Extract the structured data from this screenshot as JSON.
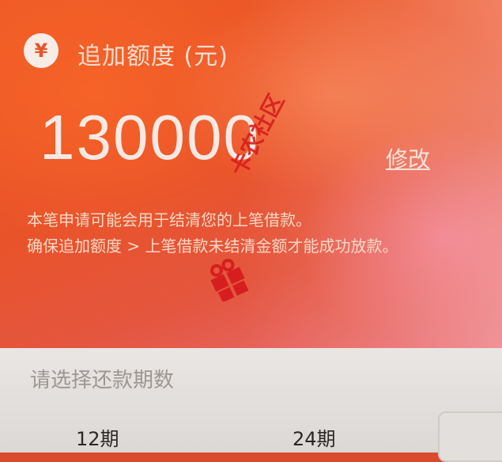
{
  "card": {
    "currency_icon": "yen-icon",
    "currency_symbol": "¥",
    "title": "追加额度 (元)",
    "amount": "130000",
    "edit_label": "修改",
    "note_line1": "本笔申请可能会用于结清您的上笔借款。",
    "note_line2": "确保追加额度 > 上笔借款未结清金额才能成功放款。"
  },
  "watermark": {
    "text": "卡农社区",
    "logo_icon": "gift-logo-icon"
  },
  "repayment": {
    "prompt": "请选择还款期数",
    "options": [
      "12期",
      "24期"
    ]
  },
  "colors": {
    "card_accent": "#e9532a",
    "sheet_bg": "#e6e3e1"
  }
}
